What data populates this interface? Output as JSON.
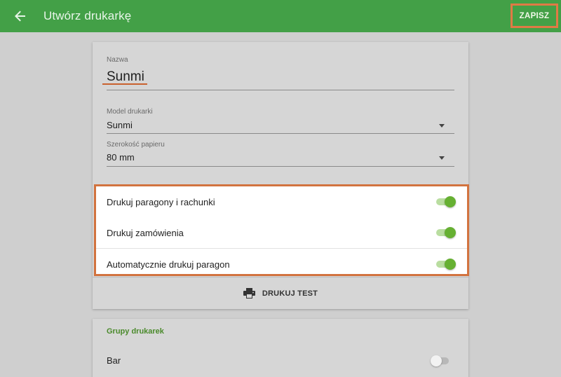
{
  "appbar": {
    "title": "Utwórz drukarkę",
    "back_icon": "arrow-left-icon",
    "save_label": "ZAPISZ",
    "color": "#43a047"
  },
  "form": {
    "name": {
      "label": "Nazwa",
      "value": "Sunmi"
    },
    "model": {
      "label": "Model drukarki",
      "value": "Sunmi"
    },
    "paper": {
      "label": "Szerokość papieru",
      "value": "80 mm"
    }
  },
  "toggles": [
    {
      "label": "Drukuj paragony i rachunki",
      "state": "on"
    },
    {
      "label": "Drukuj zamówienia",
      "state": "on"
    },
    {
      "label": "Automatycznie drukuj paragon",
      "state": "on"
    }
  ],
  "test_print": {
    "label": "DRUKUJ TEST",
    "icon": "printer-icon"
  },
  "printer_groups": {
    "title": "Grupy drukarek",
    "items": [
      {
        "label": "Bar",
        "state": "off"
      }
    ]
  },
  "colors": {
    "accent_green": "#66b032",
    "highlight_orange": "#d2733f"
  }
}
